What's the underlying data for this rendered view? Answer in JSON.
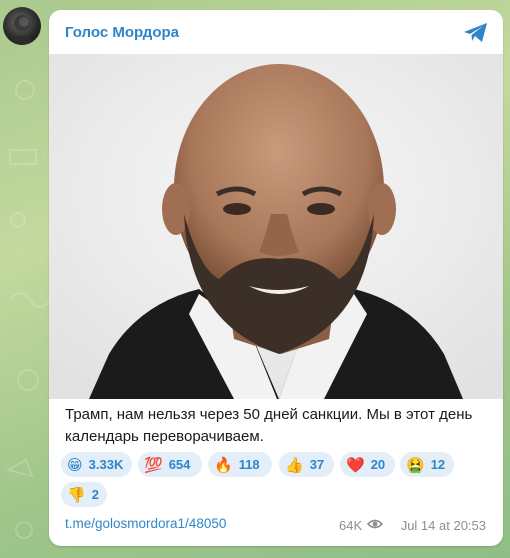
{
  "channel": {
    "name": "Голос Мордора",
    "avatar_icon": "channel-avatar",
    "share_icon": "telegram-share-icon"
  },
  "post": {
    "text": "Трамп, нам нельзя через 50 дней санкции. Мы в этот день календарь переворачиваем.",
    "reactions": [
      {
        "emoji": "😁",
        "count": "3.33K"
      },
      {
        "emoji": "💯",
        "count": "654"
      },
      {
        "emoji": "🔥",
        "count": "118"
      },
      {
        "emoji": "👍",
        "count": "37"
      },
      {
        "emoji": "❤️",
        "count": "20"
      },
      {
        "emoji": "🤮",
        "count": "12"
      },
      {
        "emoji": "👎",
        "count": "2"
      }
    ],
    "link": "t.me/golosmordora1/48050",
    "views": "64K",
    "date": "Jul 14 at 20:53"
  },
  "colors": {
    "accent": "#2e86c8",
    "reaction_bg": "#e3eef8",
    "meta_text": "#8a8f94"
  }
}
